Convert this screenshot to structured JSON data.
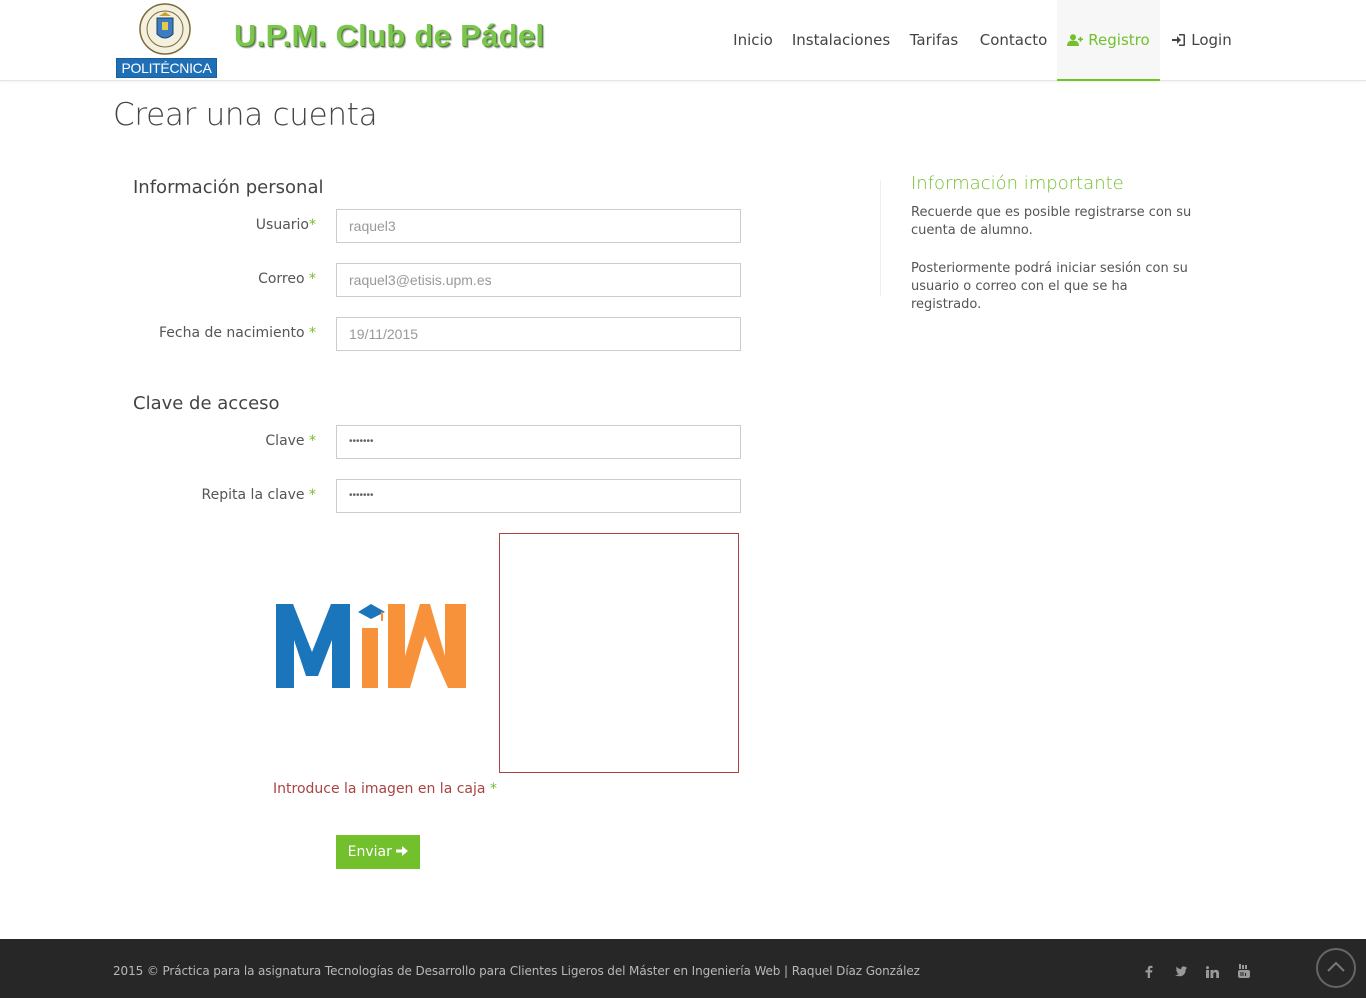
{
  "header": {
    "logo_text": "POLITÉCNICA",
    "site_title": "U.P.M. Club de Pádel",
    "nav": [
      {
        "label": "Inicio",
        "icon": ""
      },
      {
        "label": "Instalaciones",
        "icon": ""
      },
      {
        "label": "Tarifas",
        "icon": ""
      },
      {
        "label": "Contacto",
        "icon": ""
      },
      {
        "label": "Registro",
        "icon": "user-plus-icon",
        "active": true
      },
      {
        "label": "Login",
        "icon": "sign-in-icon"
      }
    ]
  },
  "page_title": "Crear una cuenta",
  "form": {
    "personal_heading": "Información personal",
    "usuario_label": "Usuario",
    "usuario_value": "raquel3",
    "correo_label": "Correo ",
    "correo_value": "raquel3@etisis.upm.es",
    "fecha_label": "Fecha de nacimiento ",
    "fecha_value": "19/11/2015",
    "clave_heading": "Clave de acceso",
    "clave_label": "Clave ",
    "clave_value": "•••••••",
    "repita_label": "Repita la clave ",
    "repita_value": "•••••••",
    "required_mark": "*",
    "captcha_label": "Introduce la imagen en la caja ",
    "submit_label": "Enviar"
  },
  "sidebar": {
    "title": "Información importante",
    "p1": "Recuerde que es posible registrarse con su cuenta de alumno.",
    "p2": "Posteriormente podrá iniciar sesión con su usuario o correo con el que se ha registrado."
  },
  "footer": {
    "text": "2015 © Práctica para la asignatura Tecnologías de Desarrollo para Clientes Ligeros del Máster en Ingeniería Web | Raquel Díaz González",
    "social": [
      "facebook-icon",
      "twitter-icon",
      "linkedin-icon",
      "youtube-icon"
    ]
  },
  "colors": {
    "accent": "#72c02c",
    "error": "#a94442",
    "footer_bg": "#272727",
    "miw_blue": "#1a75bb",
    "miw_orange": "#f7923a"
  }
}
